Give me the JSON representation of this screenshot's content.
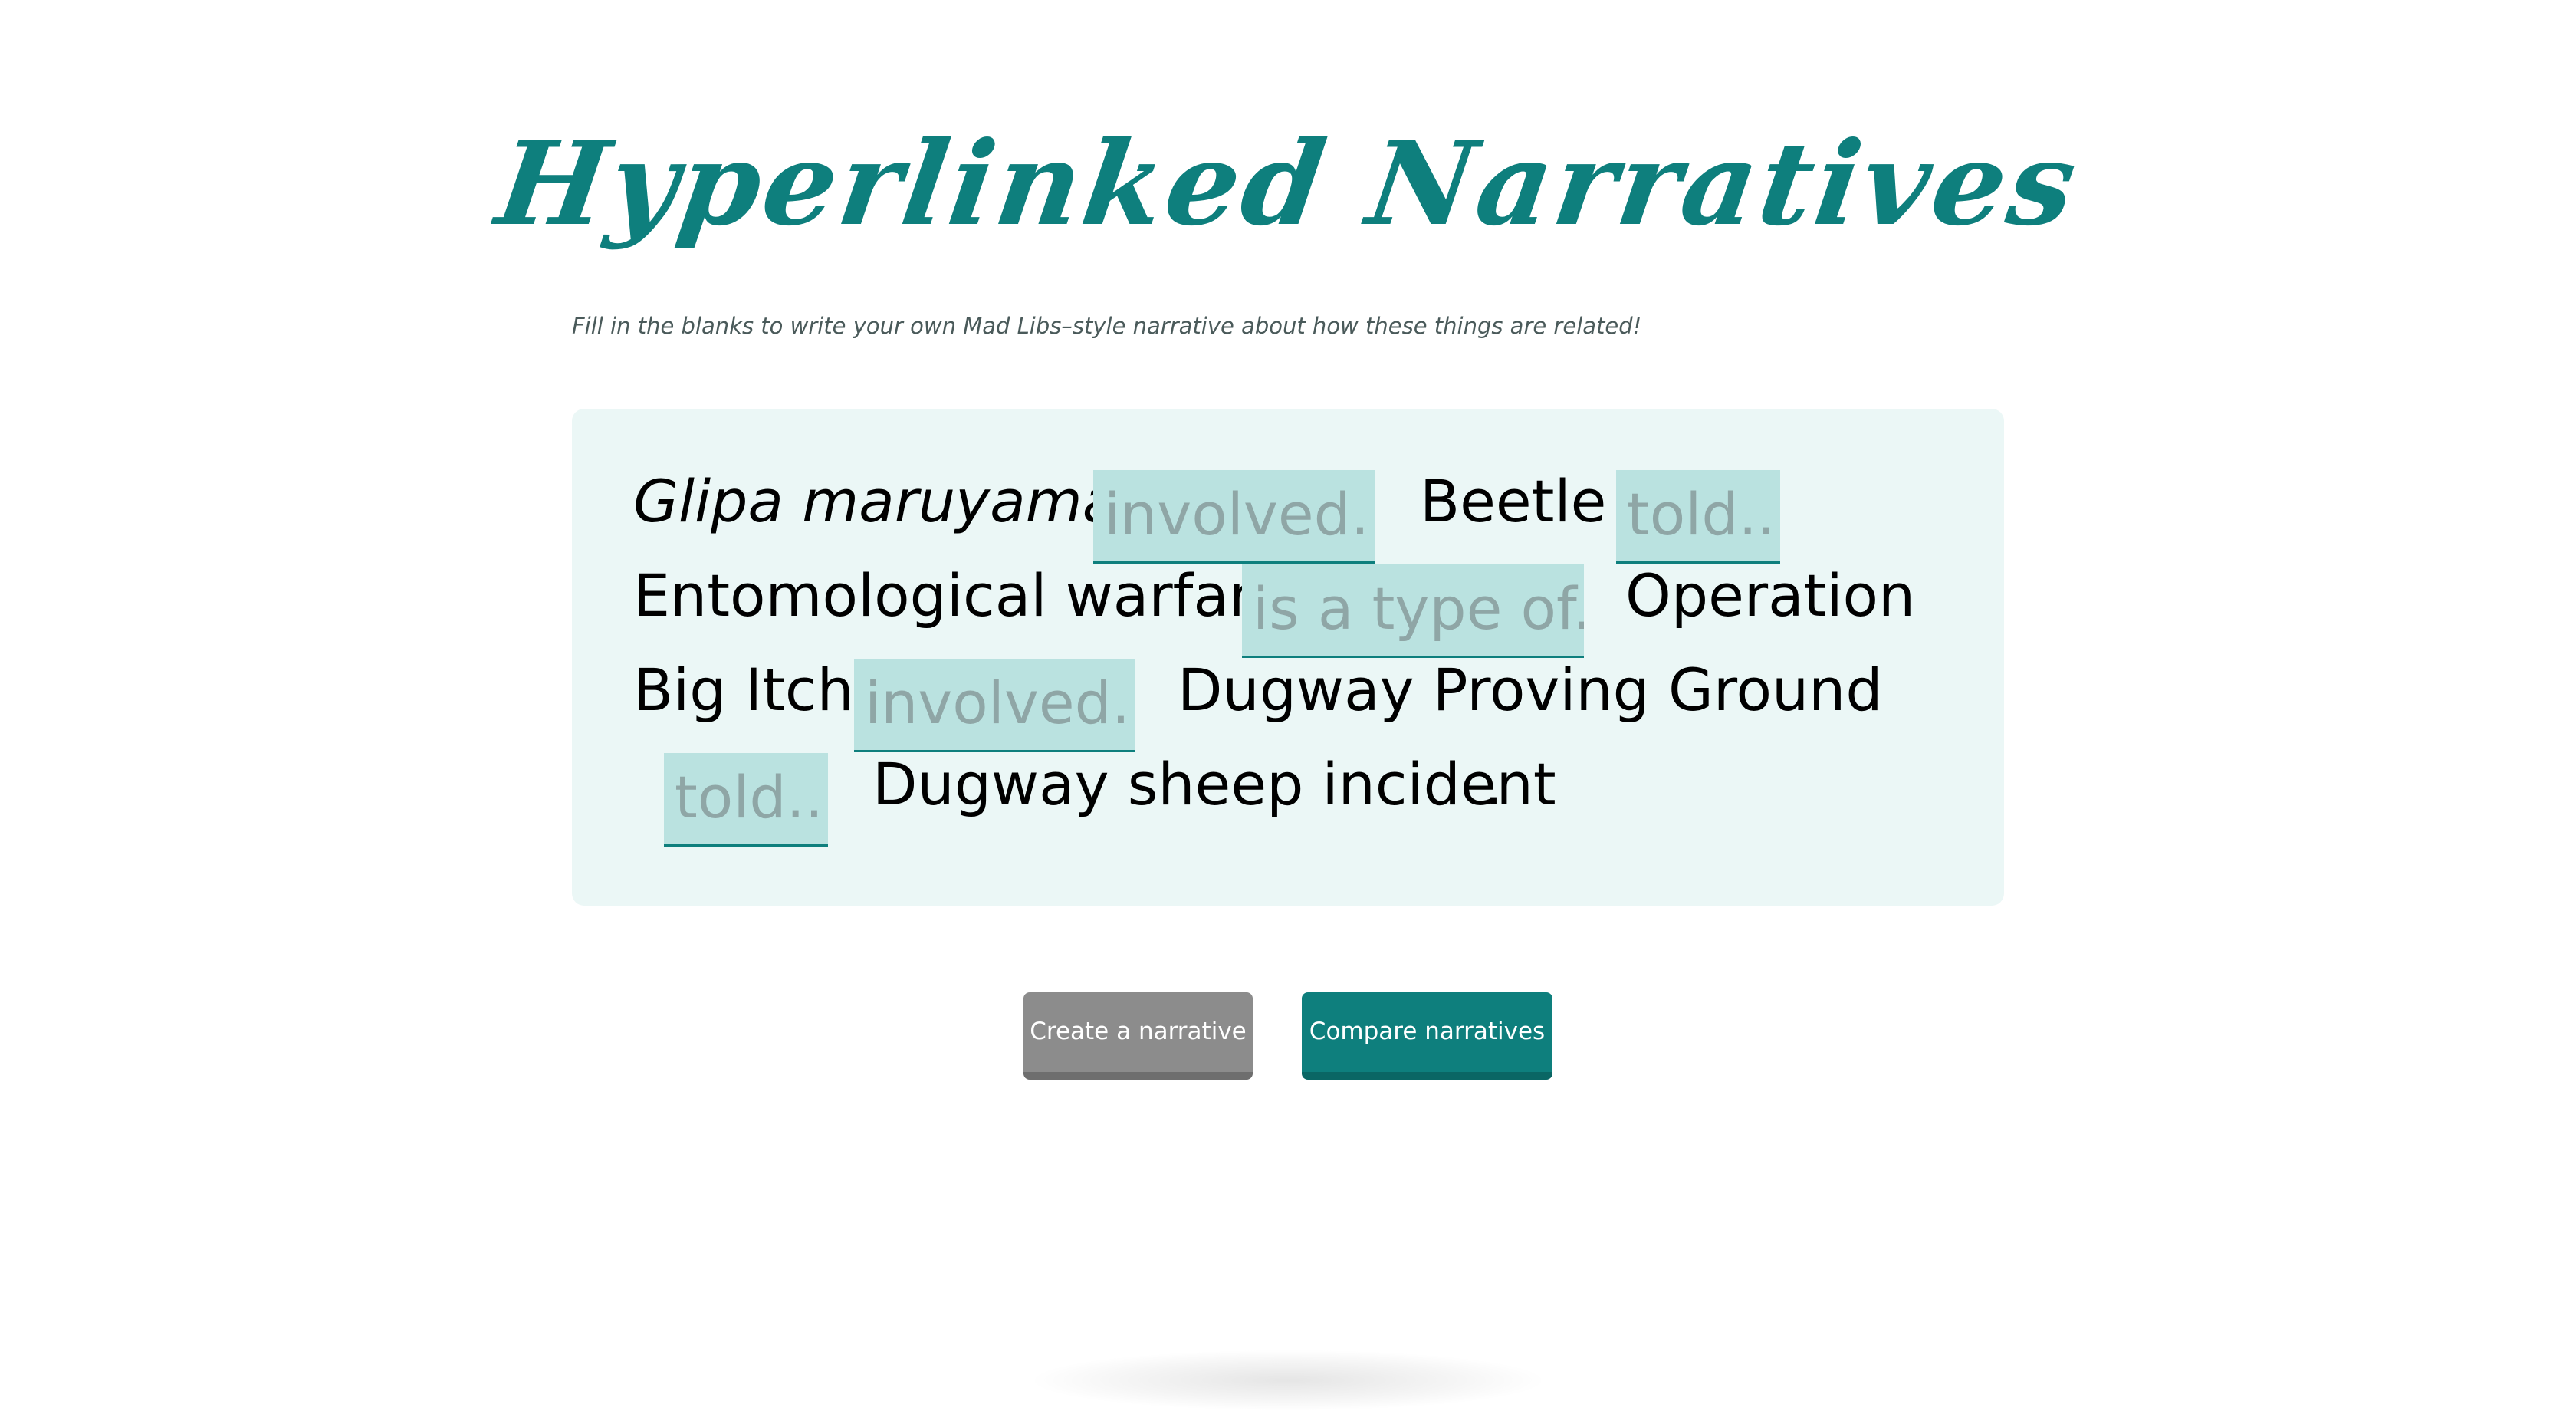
{
  "header": {
    "title": "Hyperlinked Narratives",
    "subtitle": "Fill in the blanks to write your own Mad Libs–style narrative about how these things are related!"
  },
  "narrative": {
    "entity_1": "Glipa maruyamai",
    "blank_1_placeholder": "involved...",
    "entity_2": "Beetle",
    "blank_2_placeholder": "told...",
    "entity_3": "Entomological warfare",
    "blank_3_placeholder": "is a type of...",
    "entity_4_line1": "Operation",
    "entity_4_line2": "Big Itch",
    "blank_4_placeholder": "involved...",
    "entity_5": "Dugway Proving Ground",
    "blank_5_placeholder": "told...",
    "entity_6": "Dugway sheep incident",
    "ending": "."
  },
  "buttons": {
    "create_label": "Create a narrative",
    "compare_label": "Compare narratives"
  },
  "colors": {
    "accent": "#0e7f7d",
    "box_background": "#ebf7f6",
    "blank_background": "#bae2e0",
    "blank_text": "#8fa6a6",
    "create_button": "#8c8c8c"
  }
}
